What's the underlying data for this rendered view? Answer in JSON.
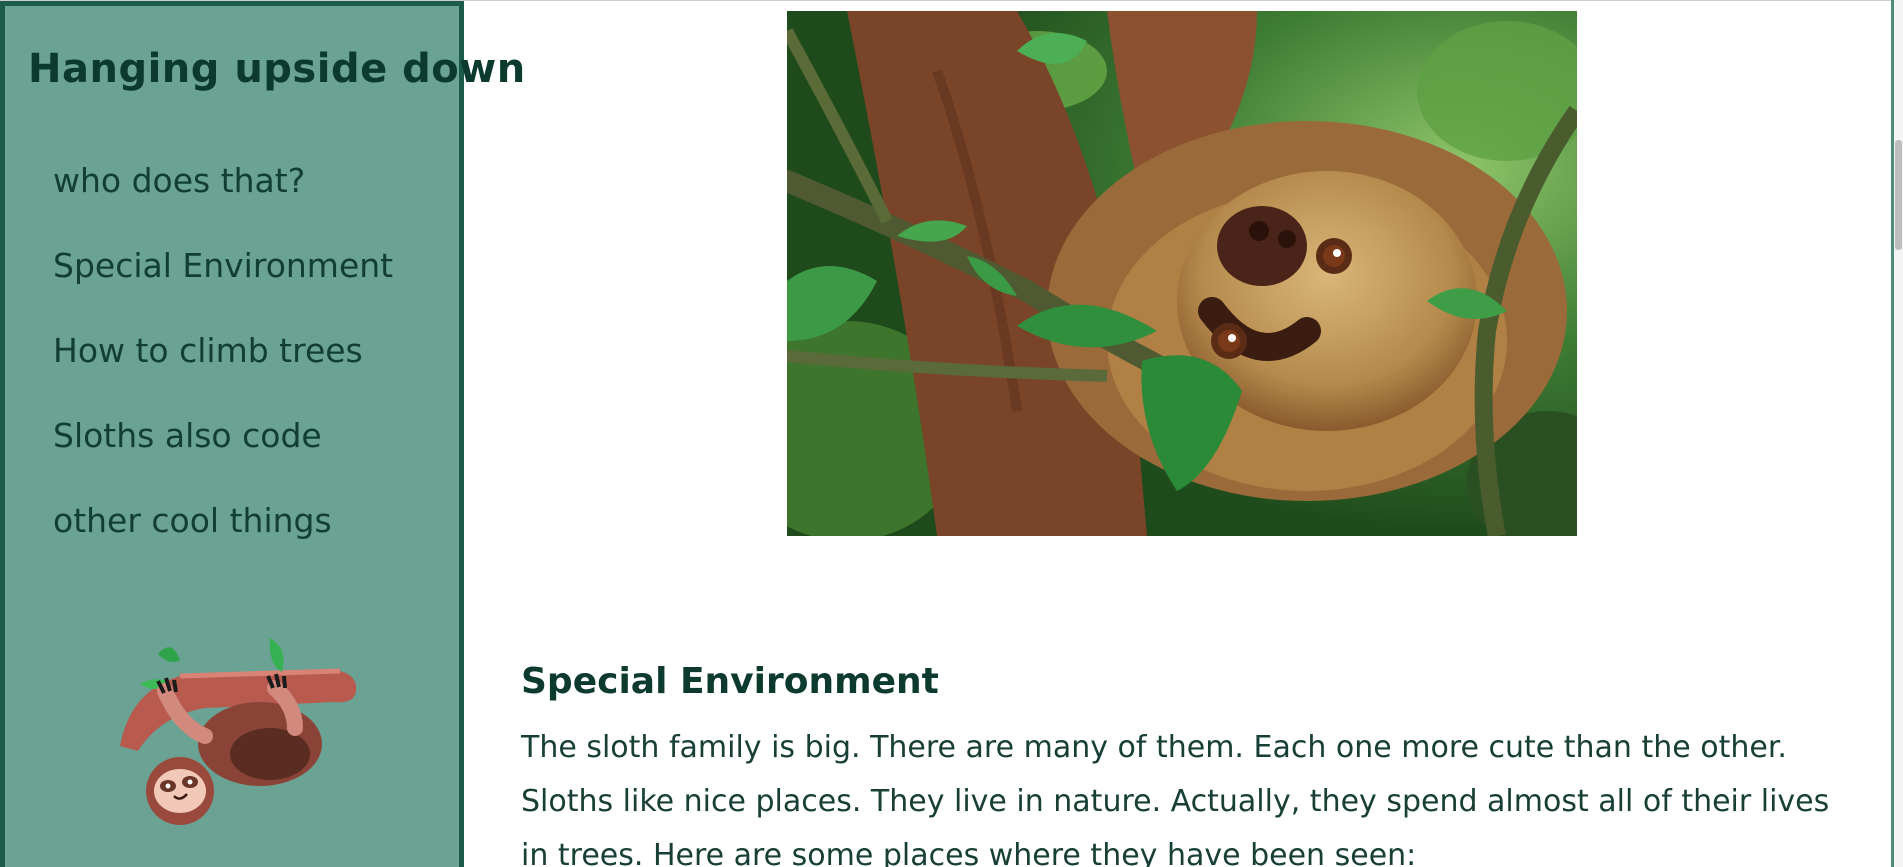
{
  "sidebar": {
    "title": "Hanging upside down",
    "nav": [
      {
        "label": "who does that?"
      },
      {
        "label": "Special Environment"
      },
      {
        "label": "How to climb trees"
      },
      {
        "label": "Sloths also code"
      },
      {
        "label": "other cool things"
      }
    ],
    "illustration": "cartoon-sloth-hanging-from-branch"
  },
  "main": {
    "hero_image": "sloth-hanging-in-tree-photo",
    "section": {
      "heading": "Special Environment",
      "text": "The sloth family is big. There are many of them. Each one more cute than the other. Sloths like nice places. They live in nature. Actually, they spend almost all of their lives in trees. Here are some places where they have been seen:"
    }
  },
  "colors": {
    "sidebar_bg": "#6aa294",
    "sidebar_border": "#1c5a4a",
    "text_dark": "#0d3a2e",
    "page_bg": "#ffffff"
  }
}
